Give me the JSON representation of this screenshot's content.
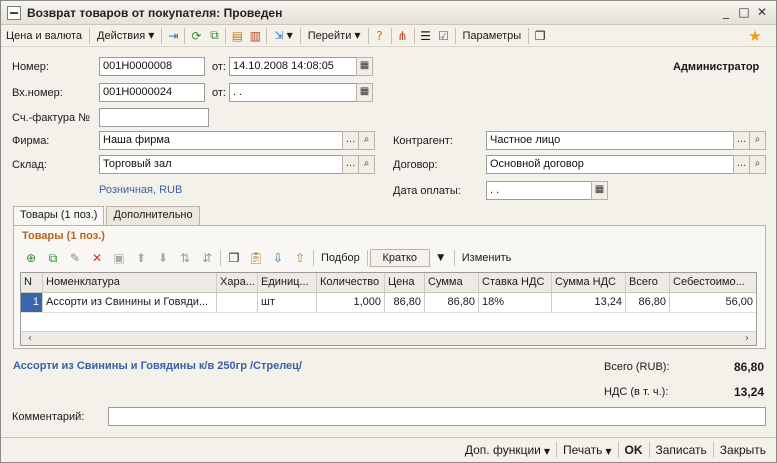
{
  "window": {
    "title": "Возврат товаров от покупателя: Проведен"
  },
  "toolbar": {
    "price_currency": "Цена и валюта",
    "actions": "Действия",
    "go": "Перейти",
    "parameters": "Параметры"
  },
  "header": {
    "user": "Администратор",
    "number_label": "Номер:",
    "number_value": "001Н0000008",
    "from_label": "от:",
    "date_value": "14.10.2008 14:08:05",
    "in_number_label": "Вх.номер:",
    "in_number_value": "001Н0000024",
    "in_from_label": "от:",
    "in_date_value": " .  .",
    "invoice_label": "Сч.-фактура №",
    "invoice_value": "",
    "firm_label": "Фирма:",
    "firm_value": "Наша фирма",
    "warehouse_label": "Склад:",
    "warehouse_value": "Торговый зал",
    "price_type_link": "Розничная, RUB",
    "counterparty_label": "Контрагент:",
    "counterparty_value": "Частное лицо",
    "contract_label": "Договор:",
    "contract_value": "Основной договор",
    "pay_date_label": "Дата оплаты:",
    "pay_date_value": " .  ."
  },
  "tabs": [
    {
      "label": "Товары (1 поз.)",
      "active": true
    },
    {
      "label": "Дополнительно",
      "active": false
    }
  ],
  "goods": {
    "title": "Товары (1 поз.)",
    "selection": "Подбор",
    "mode": "Кратко",
    "change": "Изменить",
    "columns": [
      "N",
      "Номенклатура",
      "Хара...",
      "Единиц...",
      "Количество",
      "Цена",
      "Сумма",
      "Ставка НДС",
      "Сумма НДС",
      "Всего",
      "Себестоимо..."
    ],
    "rows": [
      [
        "1",
        "Ассорти из Свинины и Говяди...",
        "",
        "шт",
        "1,000",
        "86,80",
        "86,80",
        "18%",
        "13,24",
        "86,80",
        "56,00"
      ]
    ]
  },
  "summary": {
    "item_link": "Ассорти из Свинины и Говядины к/в 250гр /Стрелец/",
    "total_label": "Всего (RUB):",
    "total_value": "86,80",
    "vat_label": "НДС (в т. ч.):",
    "vat_value": "13,24"
  },
  "comment": {
    "label": "Комментарий:",
    "value": ""
  },
  "bottom": {
    "add_functions": "Доп. функции",
    "print": "Печать",
    "ok": "OK",
    "save": "Записать",
    "close": "Закрыть"
  }
}
